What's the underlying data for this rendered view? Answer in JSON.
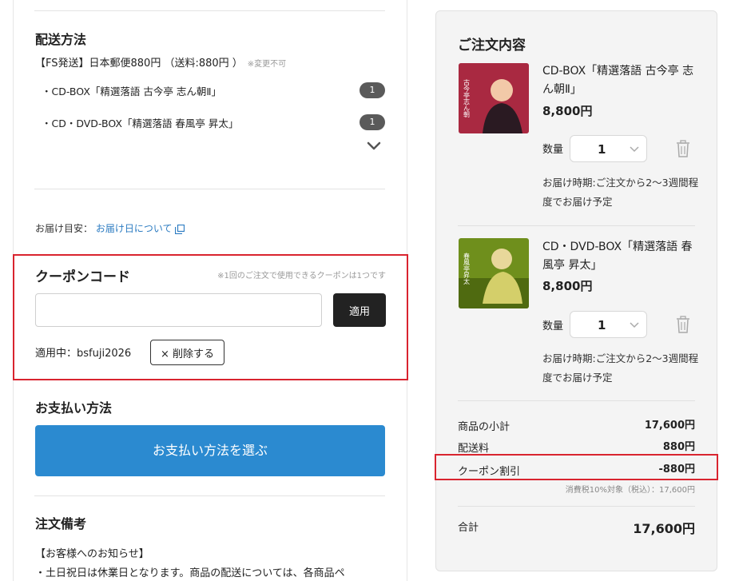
{
  "shipping": {
    "title": "配送方法",
    "method": "【FS発送】日本郵便880円 （送料:880円 ）",
    "note": "※変更不可",
    "items": [
      {
        "name": "・CD-BOX「精選落語 古今亭 志ん朝Ⅱ」",
        "count": "1"
      },
      {
        "name": "・CD・DVD-BOX「精選落語 春風亭 昇太」",
        "count": "1"
      }
    ],
    "expand_icon": "chevron-down-icon"
  },
  "delivery": {
    "label": "お届け目安：",
    "link": "お届け日について"
  },
  "coupon": {
    "title": "クーポンコード",
    "note": "※1回のご注文で使用できるクーポンは1つです",
    "input_value": "",
    "apply_label": "適用",
    "applied_text": "適用中：bsfuji2026",
    "remove_label": "× 削除する"
  },
  "payment": {
    "title": "お支払い方法",
    "button_label": "お支払い方法を選ぶ"
  },
  "remarks": {
    "title": "注文備考",
    "notice_heading": "【お客様へのお知らせ】",
    "notice_line1": "・土日祝日は休業日となります。商品の配送については、各商品ペ"
  },
  "order": {
    "title": "ご注文内容",
    "items": [
      {
        "name": "CD-BOX「精選落語 古今亭 志ん朝Ⅱ」",
        "price": "8,800円",
        "qty_label": "数量",
        "qty": "1",
        "delivery": "お届け時期:ご注文から2～3週間程度でお届け予定",
        "thumb_color": "#b8334a",
        "thumb_text": "古今亭志ん朝Ⅱ"
      },
      {
        "name": "CD・DVD-BOX「精選落語 春風亭 昇太」",
        "price": "8,800円",
        "qty_label": "数量",
        "qty": "1",
        "delivery": "お届け時期:ご注文から2～3週間程度でお届け予定",
        "thumb_color": "#6f8f1c",
        "thumb_text": "春風亭昇太"
      }
    ],
    "summary": {
      "subtotal_label": "商品の小計",
      "subtotal": "17,600円",
      "shipping_label": "配送料",
      "shipping": "880円",
      "discount_label": "クーポン割引",
      "discount": "-880円",
      "tax_note": "消費税10%対象（税込）：17,600円",
      "total_label": "合計",
      "total": "17,600円"
    }
  }
}
